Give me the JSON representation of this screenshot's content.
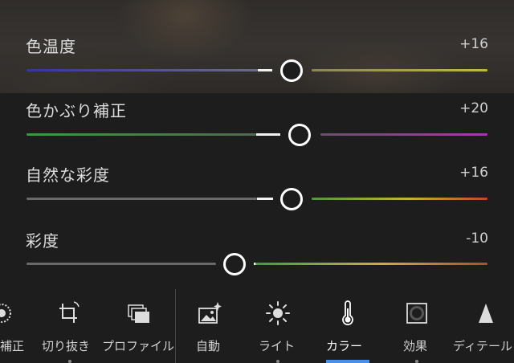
{
  "sliders": [
    {
      "label": "色温度",
      "value": "+16",
      "level": 0.58,
      "left_color": "#3d3f9c",
      "right_color": "#b7b04a"
    },
    {
      "label": "色かぶり補正",
      "value": "+20",
      "level": 0.6,
      "left_color": "#3b8f3a",
      "right_color": "#a13aa6"
    },
    {
      "label": "自然な彩度",
      "value": "+16",
      "level": 0.58,
      "left_color": "#6e6e6e",
      "right_color": "#c7b23a"
    },
    {
      "label": "彩度",
      "value": "-10",
      "level": 0.45,
      "left_color": "#6e6e6e",
      "right_color": "#c7b23a"
    }
  ],
  "toolbar": {
    "items": [
      {
        "label": "補正",
        "icon": "adjust-icon"
      },
      {
        "label": "切り抜き",
        "icon": "crop-rotate-icon"
      },
      {
        "label": "プロファイル",
        "icon": "profiles-icon"
      },
      {
        "label": "自動",
        "icon": "auto-icon"
      },
      {
        "label": "ライト",
        "icon": "light-icon"
      },
      {
        "label": "カラー",
        "icon": "color-thermometer-icon"
      },
      {
        "label": "効果",
        "icon": "effects-icon"
      },
      {
        "label": "ディテール",
        "icon": "detail-icon"
      }
    ],
    "active": "カラー",
    "active_color": "#4a8fe7"
  }
}
